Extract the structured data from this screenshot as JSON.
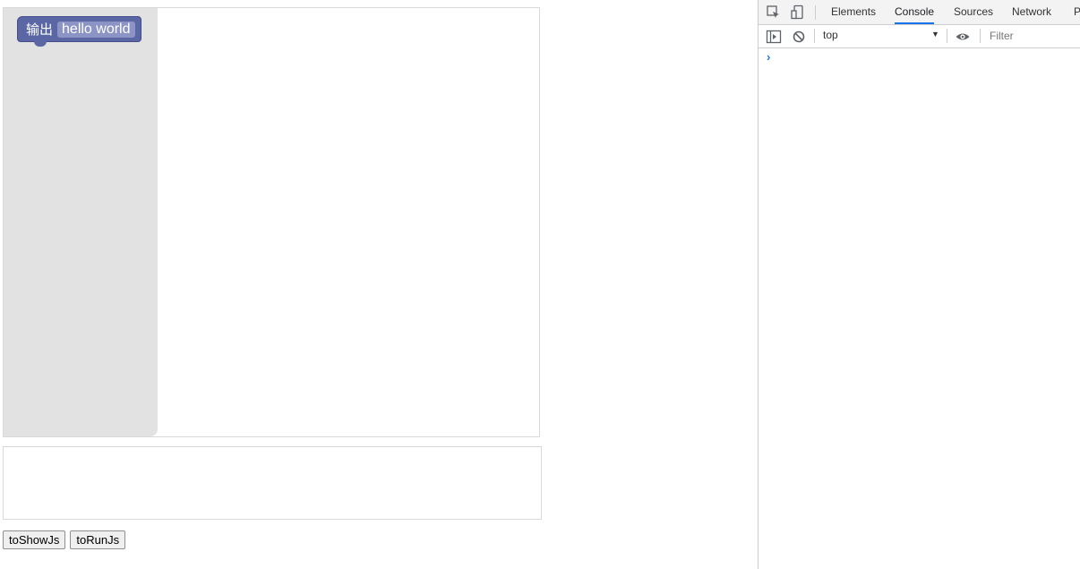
{
  "workspace": {
    "block": {
      "label": "输出",
      "text_value": "hello world",
      "color": "#5b67a5"
    }
  },
  "code_output": {
    "value": ""
  },
  "buttons": {
    "show_js": "toShowJs",
    "run_js": "toRunJs"
  },
  "devtools": {
    "tabs": [
      "Elements",
      "Console",
      "Sources",
      "Network",
      "P"
    ],
    "active_tab": "Console",
    "context": "top",
    "filter_placeholder": "Filter",
    "prompt": "›",
    "icons": [
      "inspect-element-icon",
      "device-toggle-icon",
      "sidebar-toggle-icon",
      "clear-console-icon",
      "live-expression-eye-icon"
    ],
    "accent_color": "#1a73e8"
  }
}
